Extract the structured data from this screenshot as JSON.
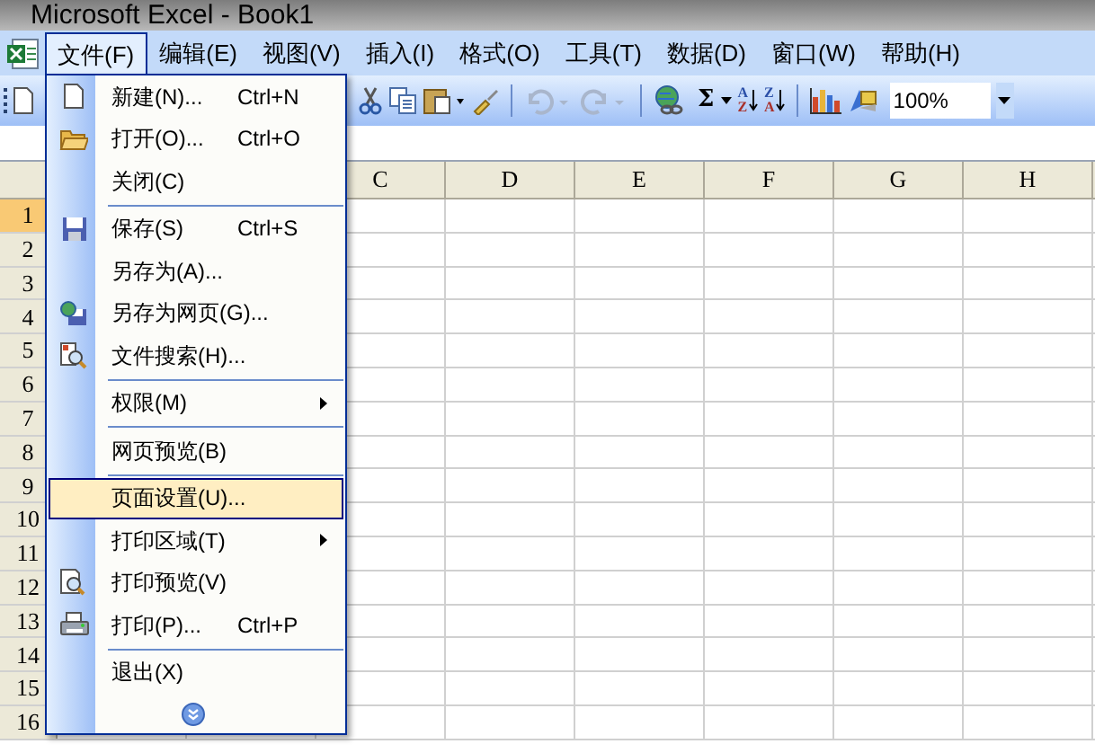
{
  "window": {
    "title": "Microsoft Excel - Book1"
  },
  "menubar": [
    {
      "label": "文件(F)",
      "selected": true
    },
    {
      "label": "编辑(E)",
      "selected": false
    },
    {
      "label": "视图(V)",
      "selected": false
    },
    {
      "label": "插入(I)",
      "selected": false
    },
    {
      "label": "格式(O)",
      "selected": false
    },
    {
      "label": "工具(T)",
      "selected": false
    },
    {
      "label": "数据(D)",
      "selected": false
    },
    {
      "label": "窗口(W)",
      "selected": false
    },
    {
      "label": "帮助(H)",
      "selected": false
    }
  ],
  "toolbar": {
    "sum": "Σ",
    "sort_ascending": {
      "top": "A",
      "bottom": "Z"
    },
    "sort_descending": {
      "top": "Z",
      "bottom": "A"
    },
    "zoom": "100%"
  },
  "columns": [
    "C",
    "D",
    "E",
    "F",
    "G",
    "H"
  ],
  "rows": [
    {
      "label": "1",
      "selected": true
    },
    {
      "label": "2",
      "selected": false
    },
    {
      "label": "3",
      "selected": false
    },
    {
      "label": "4",
      "selected": false
    },
    {
      "label": "5",
      "selected": false
    },
    {
      "label": "6",
      "selected": false
    },
    {
      "label": "7",
      "selected": false
    },
    {
      "label": "8",
      "selected": false
    },
    {
      "label": "9",
      "selected": false
    },
    {
      "label": "10",
      "selected": false
    },
    {
      "label": "11",
      "selected": false
    },
    {
      "label": "12",
      "selected": false
    },
    {
      "label": "13",
      "selected": false
    },
    {
      "label": "14",
      "selected": false
    },
    {
      "label": "15",
      "selected": false
    },
    {
      "label": "16",
      "selected": false
    }
  ],
  "file_menu": [
    {
      "kind": "item",
      "label": "新建(N)...",
      "shortcut": "Ctrl+N",
      "submenu": false,
      "selected": false
    },
    {
      "kind": "item",
      "label": "打开(O)...",
      "shortcut": "Ctrl+O",
      "submenu": false,
      "selected": false
    },
    {
      "kind": "item",
      "label": "关闭(C)",
      "submenu": false,
      "selected": false
    },
    {
      "kind": "separator"
    },
    {
      "kind": "item",
      "label": "保存(S)",
      "shortcut": "Ctrl+S",
      "submenu": false,
      "selected": false
    },
    {
      "kind": "item",
      "label": "另存为(A)...",
      "submenu": false,
      "selected": false
    },
    {
      "kind": "item",
      "label": "另存为网页(G)...",
      "submenu": false,
      "selected": false
    },
    {
      "kind": "item",
      "label": "文件搜索(H)...",
      "submenu": false,
      "selected": false
    },
    {
      "kind": "separator"
    },
    {
      "kind": "item",
      "label": "权限(M)",
      "submenu": true,
      "selected": false
    },
    {
      "kind": "separator"
    },
    {
      "kind": "item",
      "label": "网页预览(B)",
      "submenu": false,
      "selected": false
    },
    {
      "kind": "separator"
    },
    {
      "kind": "item",
      "label": "页面设置(U)...",
      "submenu": false,
      "selected": true
    },
    {
      "kind": "item",
      "label": "打印区域(T)",
      "submenu": true,
      "selected": false
    },
    {
      "kind": "item",
      "label": "打印预览(V)",
      "submenu": false,
      "selected": false
    },
    {
      "kind": "item",
      "label": "打印(P)...",
      "shortcut": "Ctrl+P",
      "submenu": false,
      "selected": false
    },
    {
      "kind": "separator"
    },
    {
      "kind": "item",
      "label": "退出(X)",
      "submenu": false,
      "selected": false
    },
    {
      "kind": "expand"
    }
  ]
}
